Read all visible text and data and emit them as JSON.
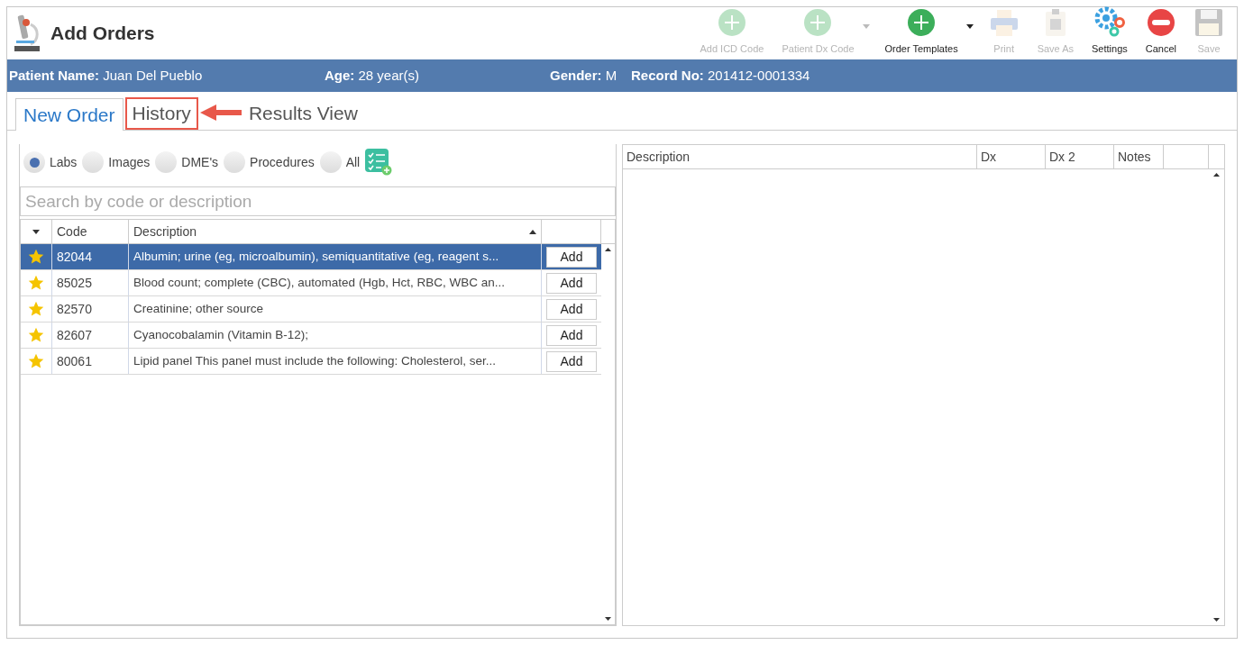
{
  "window": {
    "title": "Add Orders"
  },
  "toolbar": [
    {
      "label": "Add ICD Code",
      "disabled": true,
      "dropdown": false
    },
    {
      "label": "Patient Dx Code",
      "disabled": true,
      "dropdown": true
    },
    {
      "label": "Order Templates",
      "disabled": false,
      "dropdown": true
    },
    {
      "label": "Print",
      "disabled": true,
      "dropdown": false
    },
    {
      "label": "Save As",
      "disabled": true,
      "dropdown": false
    },
    {
      "label": "Settings",
      "disabled": false,
      "dropdown": false
    },
    {
      "label": "Cancel",
      "disabled": false,
      "dropdown": false
    },
    {
      "label": "Save",
      "disabled": true,
      "dropdown": false
    }
  ],
  "patient_bar": [
    {
      "label": "Patient Name:",
      "value": "Juan Del Pueblo"
    },
    {
      "label": "Age:",
      "value": "28 year(s)"
    },
    {
      "label": "Gender:",
      "value": "M"
    },
    {
      "label": "Record No:",
      "value": "201412-0001334"
    }
  ],
  "tabs": [
    {
      "label": "New Order",
      "selected": true,
      "highlighted": false
    },
    {
      "label": "History",
      "selected": false,
      "highlighted": true
    },
    {
      "label": "Results View",
      "selected": false,
      "highlighted": false
    }
  ],
  "filters": [
    {
      "label": "Labs",
      "selected": true
    },
    {
      "label": "Images",
      "selected": false
    },
    {
      "label": "DME's",
      "selected": false
    },
    {
      "label": "Procedures",
      "selected": false
    },
    {
      "label": "All",
      "selected": false
    }
  ],
  "search": {
    "placeholder": "Search by code or description"
  },
  "orders_table": {
    "columns": [
      "Code",
      "Description"
    ],
    "rows": [
      {
        "starred": true,
        "code": "82044",
        "description": "Albumin; urine (eg, microalbumin), semiquantitative (eg, reagent s...",
        "action": "Add",
        "selected": true
      },
      {
        "starred": true,
        "code": "85025",
        "description": "Blood count; complete (CBC), automated (Hgb, Hct, RBC, WBC an...",
        "action": "Add",
        "selected": false
      },
      {
        "starred": true,
        "code": "82570",
        "description": "Creatinine; other source",
        "action": "Add",
        "selected": false
      },
      {
        "starred": true,
        "code": "82607",
        "description": "Cyanocobalamin (Vitamin B-12);",
        "action": "Add",
        "selected": false
      },
      {
        "starred": true,
        "code": "80061",
        "description": "Lipid panel This panel must include the following: Cholesterol, ser...",
        "action": "Add",
        "selected": false
      }
    ]
  },
  "selected_table": {
    "columns": [
      "Description",
      "Dx",
      "Dx 2",
      "Notes"
    ]
  }
}
